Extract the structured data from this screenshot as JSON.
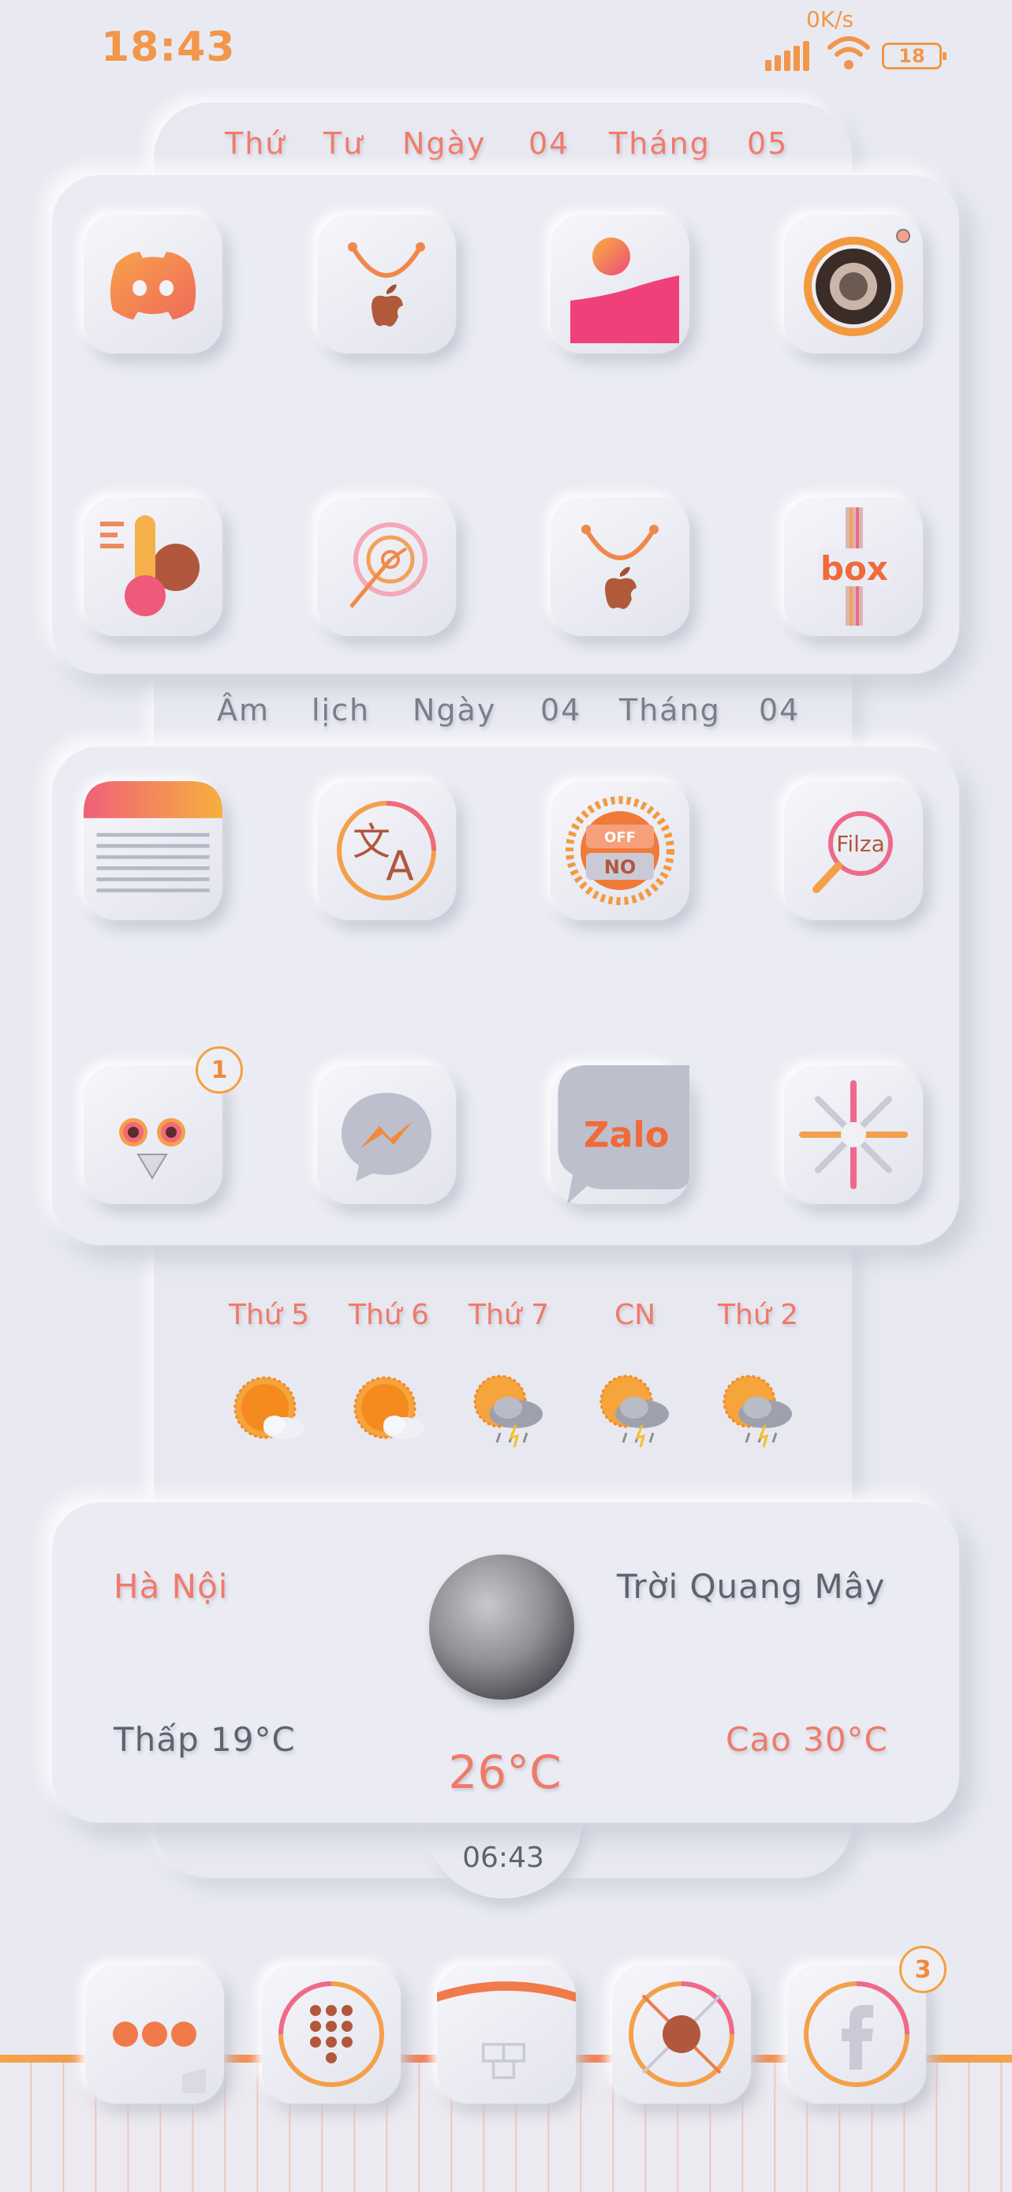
{
  "status_bar": {
    "time": "18:43",
    "net_speed": "0K/s",
    "battery": "18",
    "accent": "#f2964a"
  },
  "solar_date": {
    "parts": [
      "Thứ",
      "Tư",
      "Ngày",
      "04",
      "Tháng",
      "05"
    ]
  },
  "lunar_date": {
    "parts": [
      "Âm",
      "lịch",
      "Ngày",
      "04",
      "Tháng",
      "04"
    ]
  },
  "page1_apps": [
    {
      "icon": "discord-icon"
    },
    {
      "icon": "app-store-icon"
    },
    {
      "icon": "photos-icon"
    },
    {
      "icon": "camera-icon"
    },
    {
      "icon": "thermometer-icon"
    },
    {
      "icon": "clock-target-icon"
    },
    {
      "icon": "app-store-icon"
    },
    {
      "icon": "box-icon",
      "text": "box"
    }
  ],
  "page2_apps": [
    {
      "icon": "notes-icon"
    },
    {
      "icon": "translate-icon"
    },
    {
      "icon": "toggle-sun-icon",
      "text_top": "OFF",
      "text_bottom": "NO"
    },
    {
      "icon": "filza-search-icon",
      "text": "Filza"
    },
    {
      "icon": "owl-icon",
      "badge": "1"
    },
    {
      "icon": "messenger-icon"
    },
    {
      "icon": "zalo-icon",
      "text": "Zalo"
    },
    {
      "icon": "snowflake-icon"
    }
  ],
  "forecast": [
    {
      "day": "Thứ 5",
      "icon": "sun-cloud-icon"
    },
    {
      "day": "Thứ 6",
      "icon": "sun-cloud-icon"
    },
    {
      "day": "Thứ 7",
      "icon": "storm-icon"
    },
    {
      "day": "CN",
      "icon": "storm-icon"
    },
    {
      "day": "Thứ 2",
      "icon": "storm-icon"
    }
  ],
  "weather": {
    "city": "Hà Nội",
    "condition": "Trời Quang Mây",
    "low": "Thấp 19°C",
    "high": "Cao 30°C",
    "current": "26°C",
    "clock": "06:43"
  },
  "dock": [
    {
      "icon": "messages-icon"
    },
    {
      "icon": "phone-keypad-icon"
    },
    {
      "icon": "cydia-icon"
    },
    {
      "icon": "safari-compass-icon"
    },
    {
      "icon": "facebook-icon",
      "badge": "3"
    }
  ]
}
